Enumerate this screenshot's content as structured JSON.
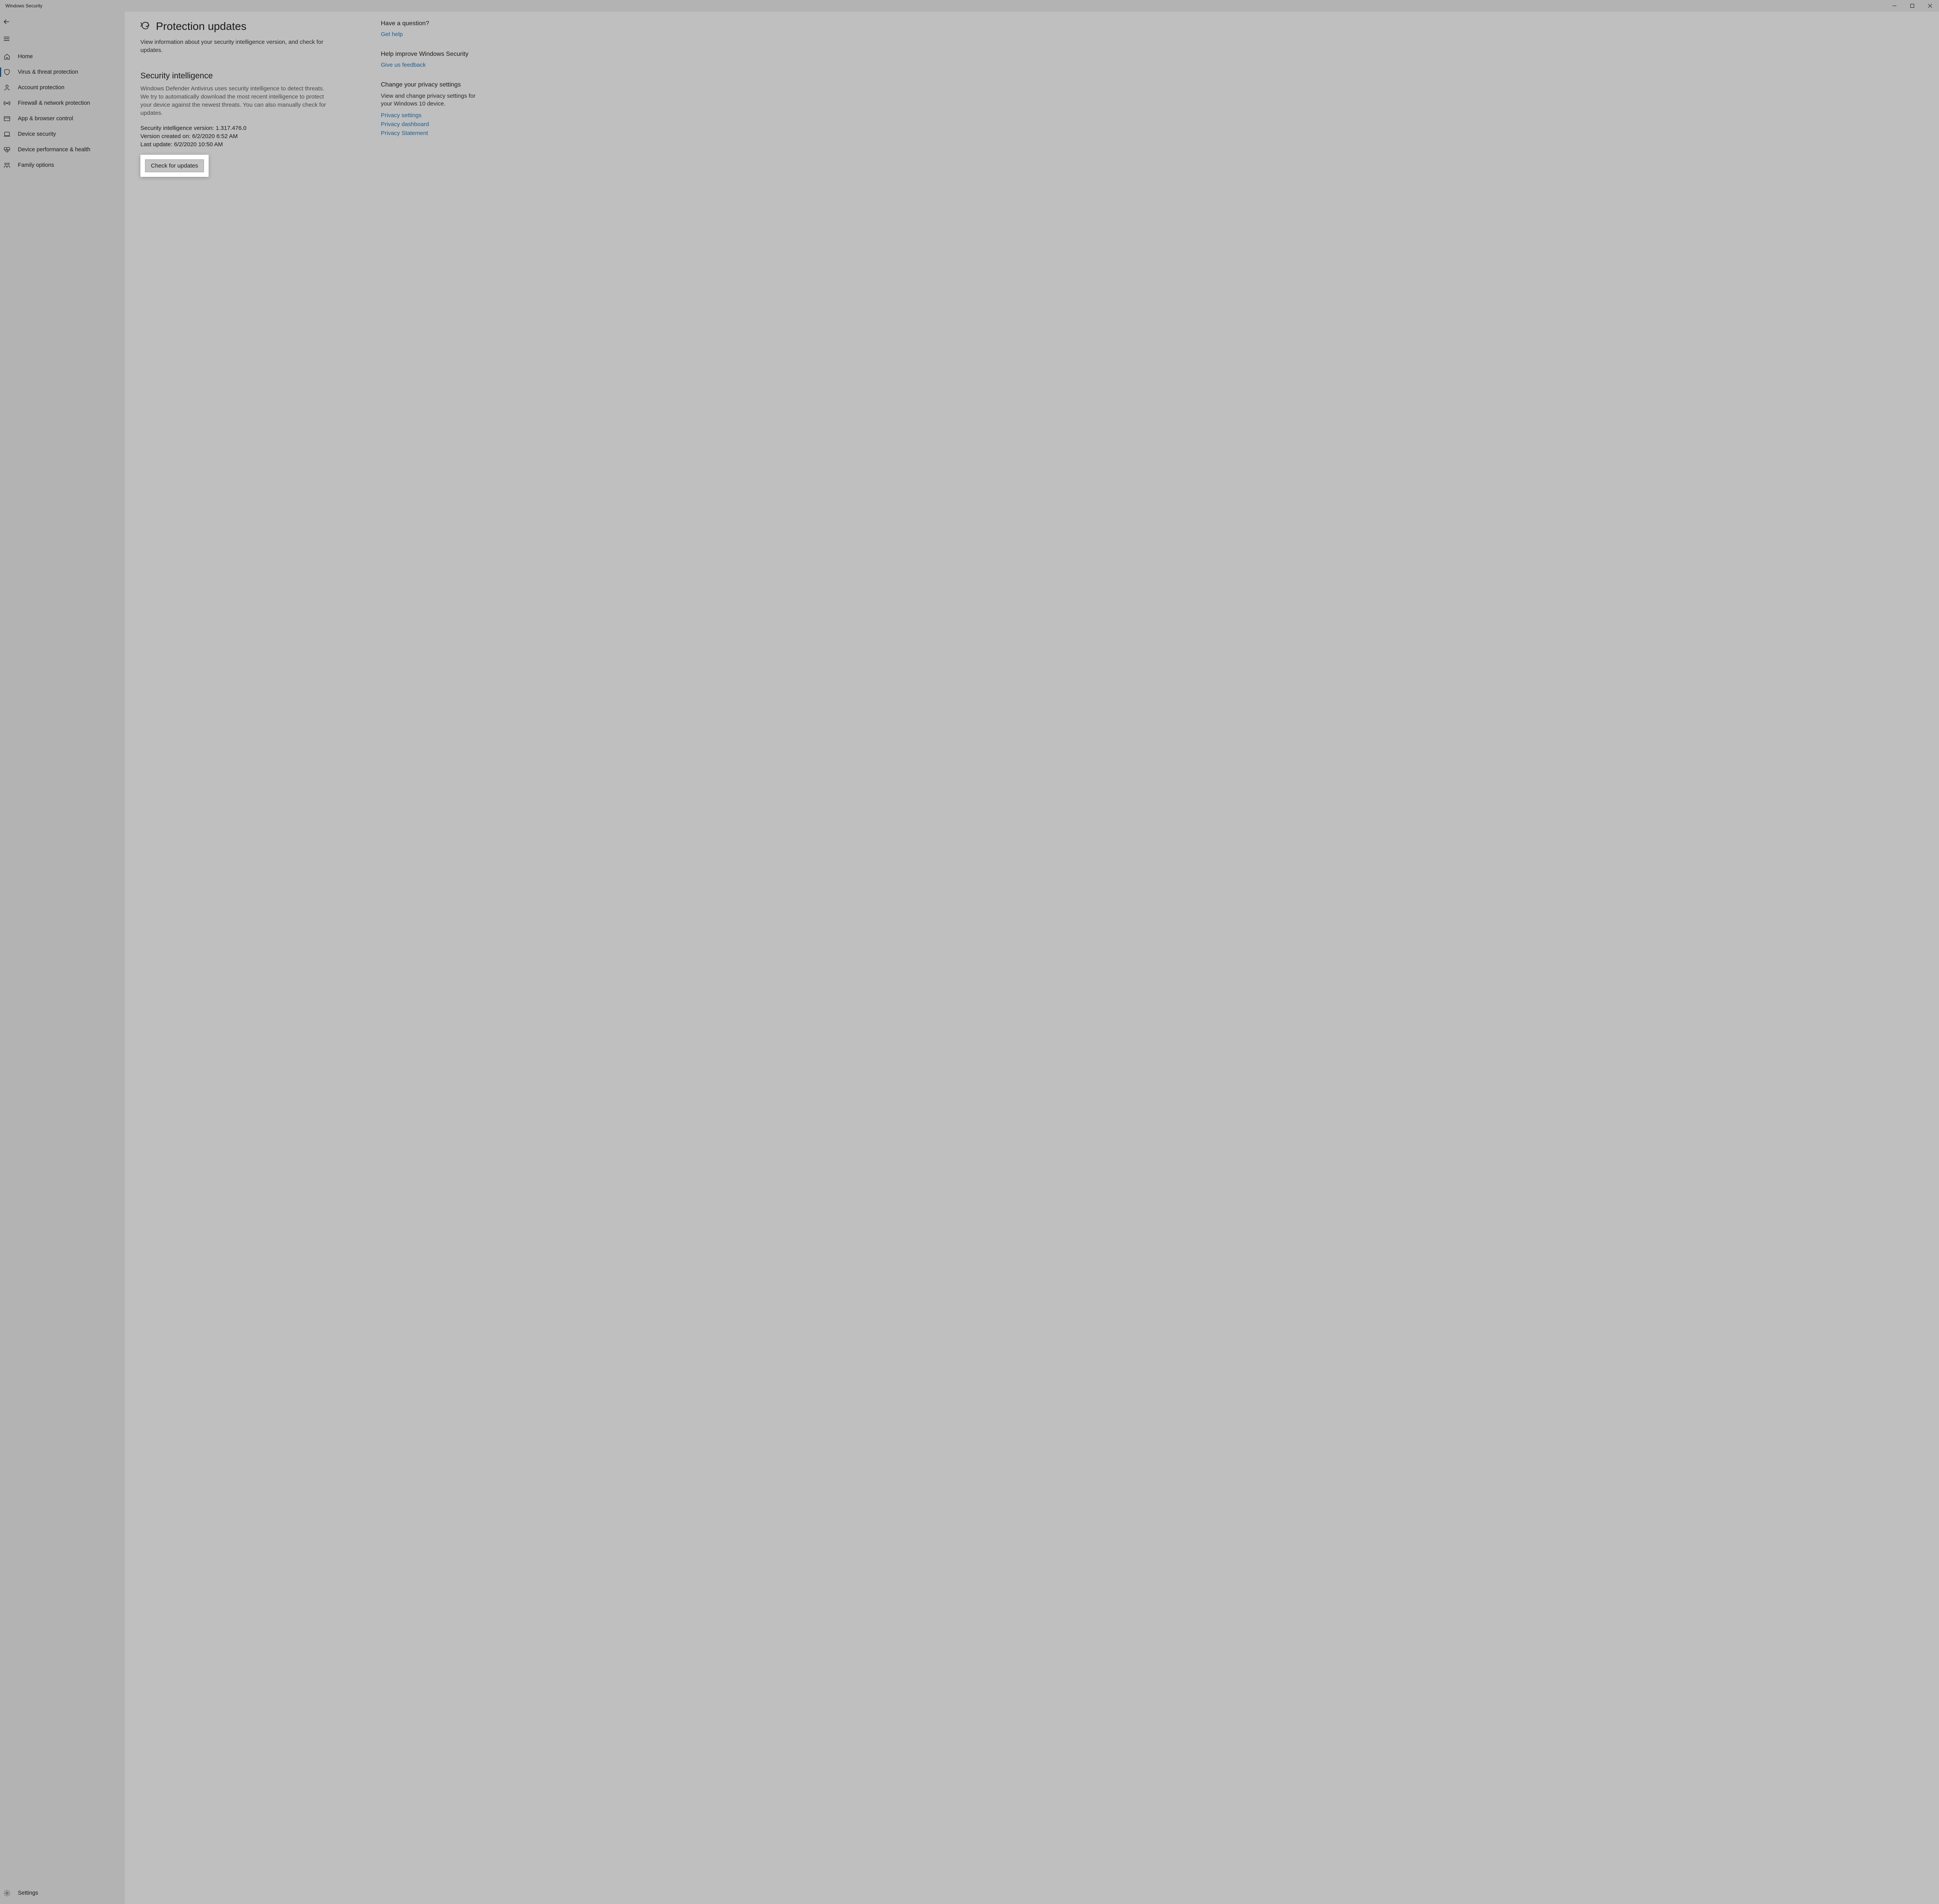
{
  "window": {
    "title": "Windows Security"
  },
  "sidebar": {
    "items": [
      {
        "label": "Home",
        "icon": "home"
      },
      {
        "label": "Virus & threat protection",
        "icon": "shield",
        "active": true
      },
      {
        "label": "Account protection",
        "icon": "person"
      },
      {
        "label": "Firewall & network protection",
        "icon": "antenna"
      },
      {
        "label": "App & browser control",
        "icon": "browser"
      },
      {
        "label": "Device security",
        "icon": "device"
      },
      {
        "label": "Device performance & health",
        "icon": "heart"
      },
      {
        "label": "Family options",
        "icon": "family"
      }
    ],
    "settings_label": "Settings"
  },
  "page": {
    "title": "Protection updates",
    "subtitle": "View information about your security intelligence version, and check for updates."
  },
  "section": {
    "heading": "Security intelligence",
    "description": "Windows Defender Antivirus uses security intelligence to detect threats. We try to automatically download the most recent intelligence to protect your device against the newest threats. You can also manually check for updates.",
    "version_line": "Security intelligence version: 1.317.476.0",
    "created_line": "Version created on: 6/2/2020 6:52 AM",
    "updated_line": "Last update: 6/2/2020 10:50 AM",
    "check_button_label": "Check for updates"
  },
  "side": {
    "question": {
      "heading": "Have a question?",
      "link": "Get help"
    },
    "feedback": {
      "heading": "Help improve Windows Security",
      "link": "Give us feedback"
    },
    "privacy": {
      "heading": "Change your privacy settings",
      "text": "View and change privacy settings for your Windows 10 device.",
      "links": [
        "Privacy settings",
        "Privacy dashboard",
        "Privacy Statement"
      ]
    }
  }
}
